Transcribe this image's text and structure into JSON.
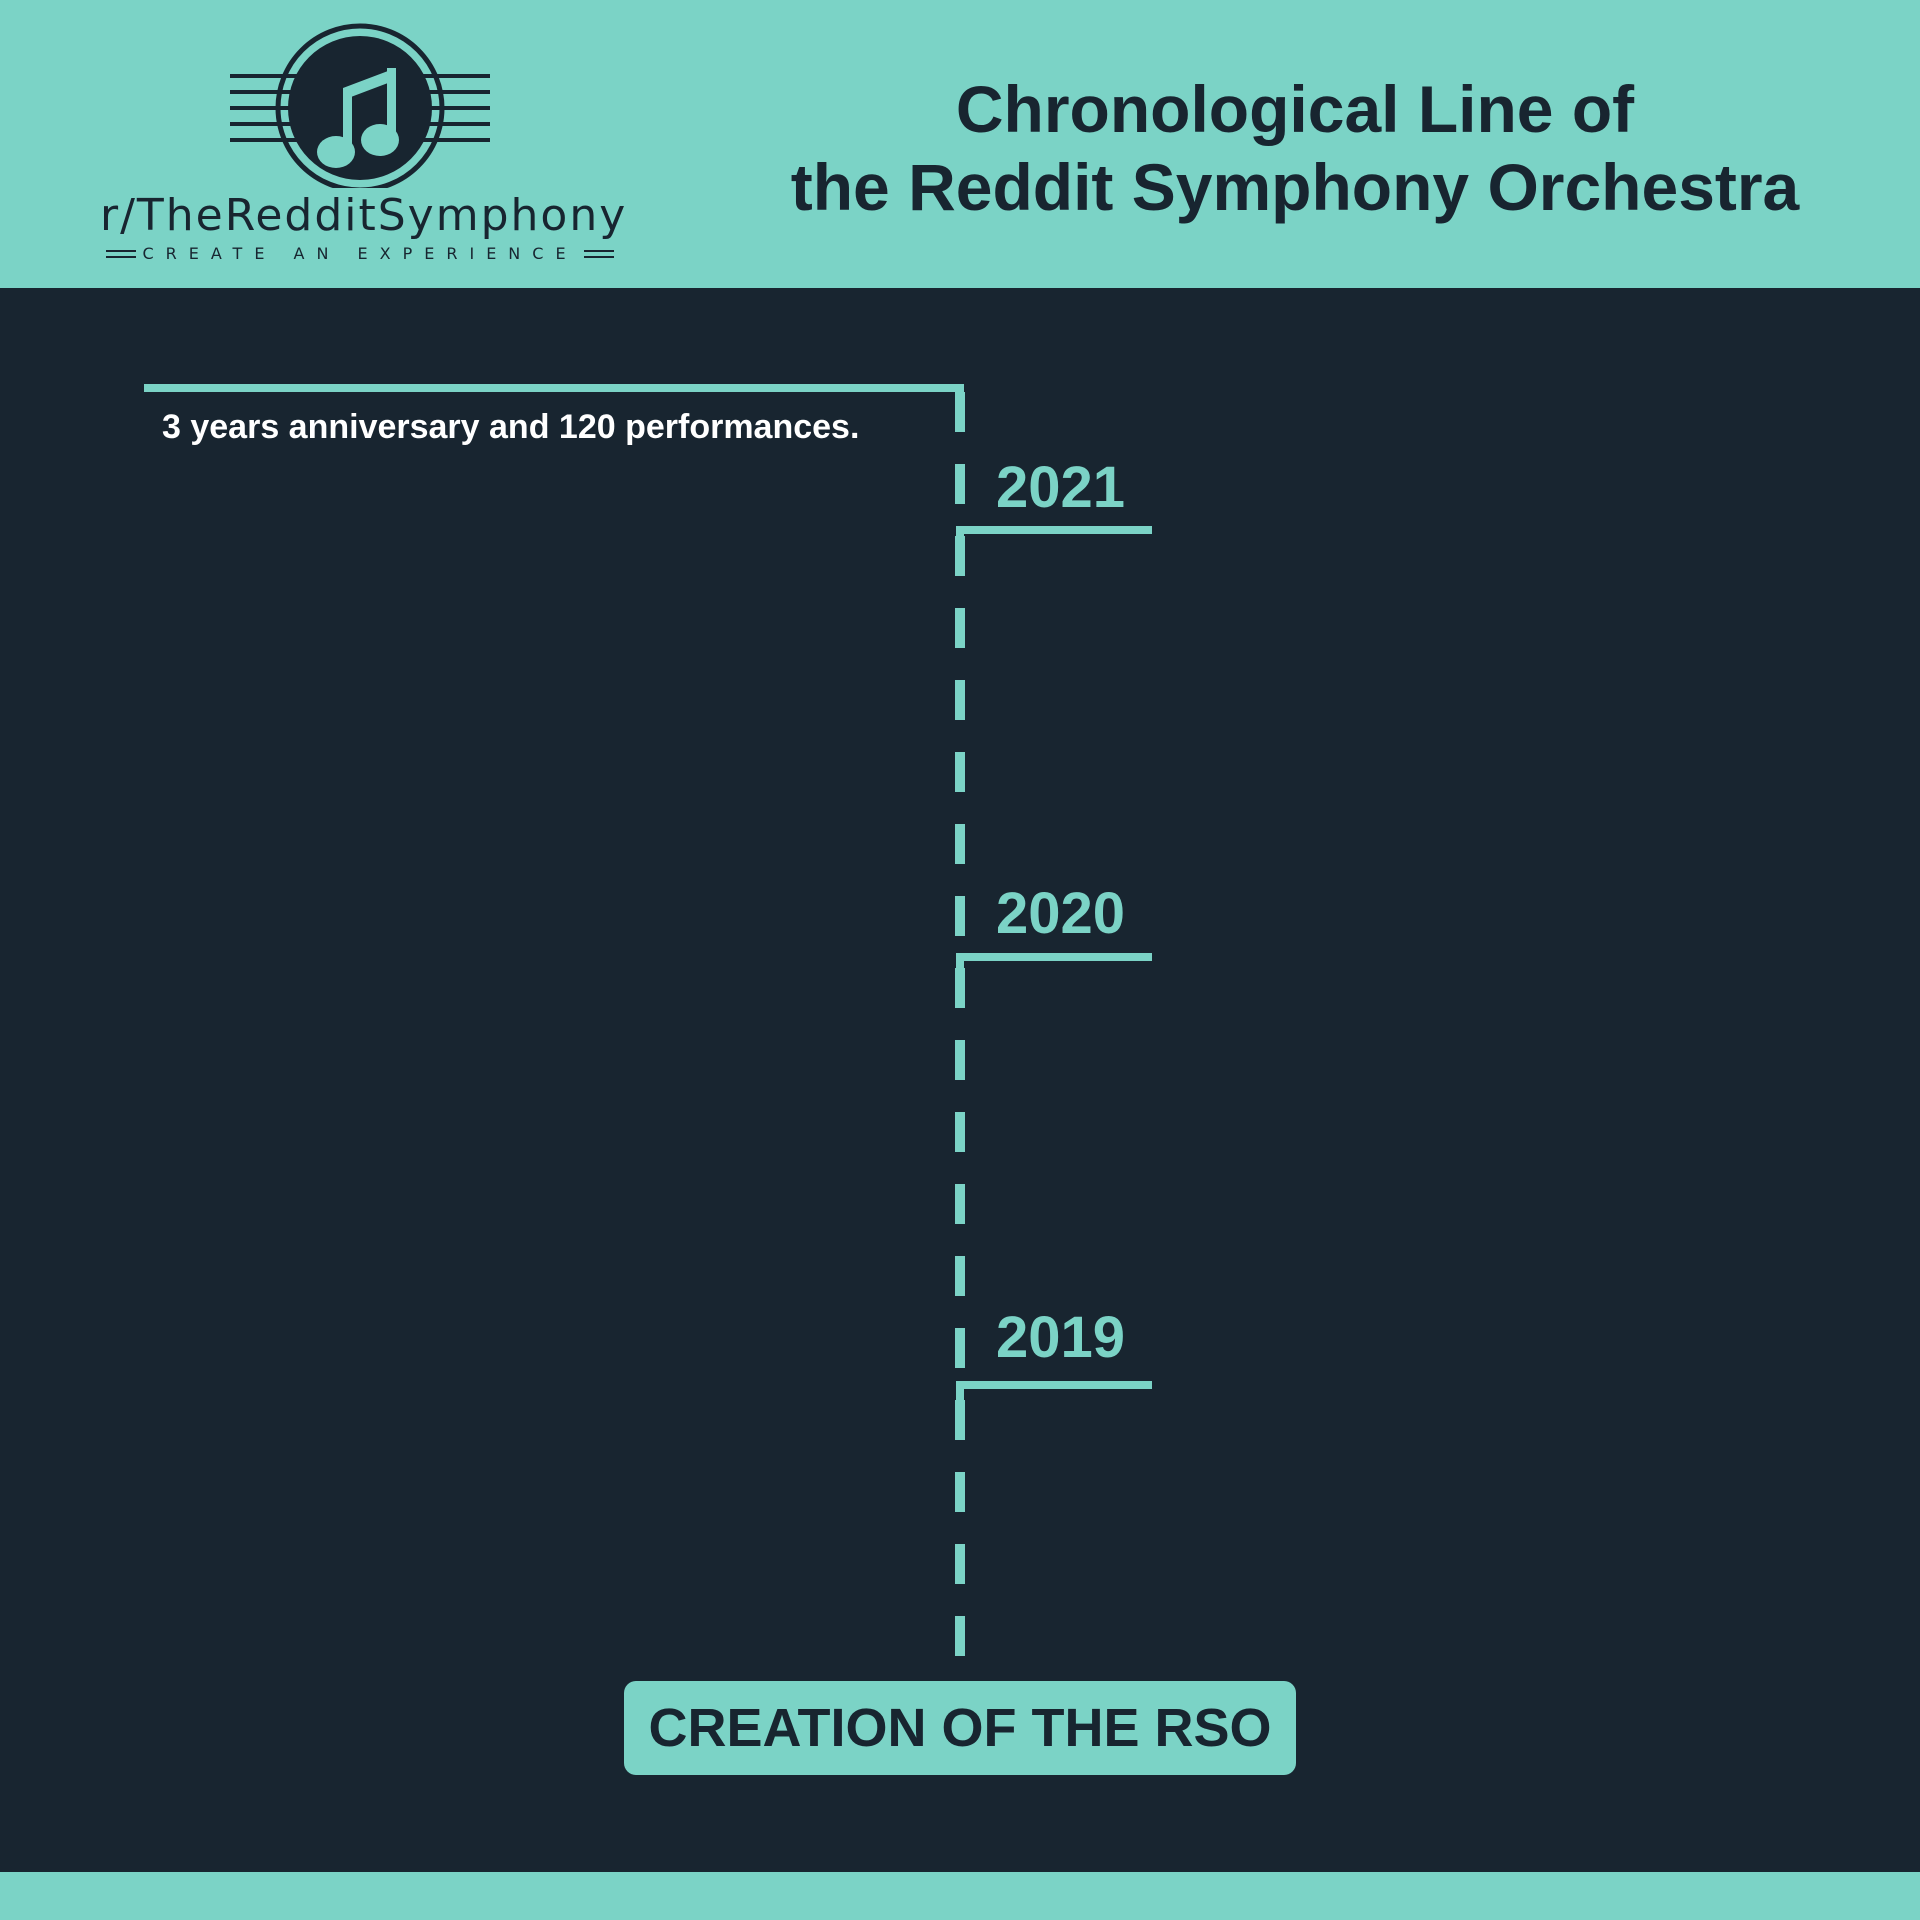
{
  "header": {
    "logo": {
      "name": "r/TheRedditSymphony",
      "tagline": "CREATE AN EXPERIENCE",
      "icon": "music-note-icon"
    },
    "title_line1": "Chronological Line of",
    "title_line2": "the Reddit Symphony Orchestra"
  },
  "timeline": {
    "top_note": "3 years anniversary and 120 performances.",
    "milestones": [
      {
        "year": "2021"
      },
      {
        "year": "2020"
      },
      {
        "year": "2019"
      }
    ],
    "start_label": "CREATION OF THE RSO"
  },
  "colors": {
    "teal": "#7bd3c6",
    "navy": "#182530",
    "white": "#ffffff"
  }
}
